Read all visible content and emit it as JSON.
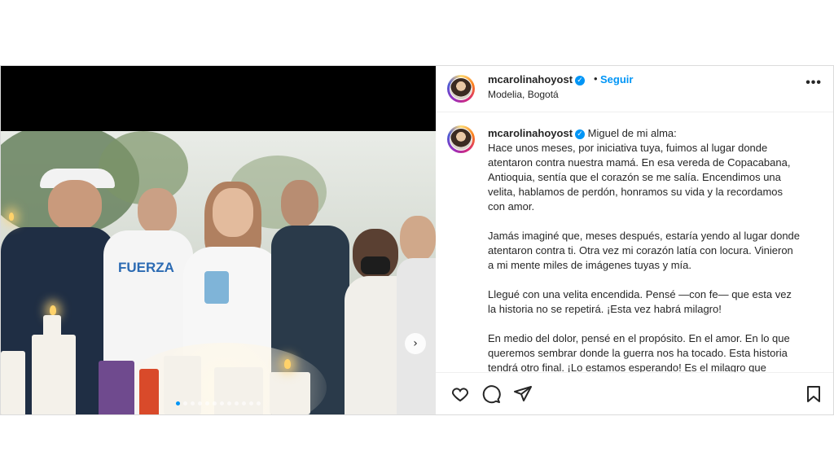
{
  "post": {
    "username": "mcarolinahoyost",
    "verified": true,
    "follow_label": "Seguir",
    "separator": "•",
    "location": "Modelia, Bogotá",
    "more_label": "•••"
  },
  "photo": {
    "shirt_text": "FUERZA",
    "carousel_dots": 12,
    "active_dot": 0
  },
  "caption": {
    "username": "mcarolinahoyost",
    "lines": [
      "Miguel de mi alma:",
      "Hace unos meses, por iniciativa tuya, fuimos al lugar donde",
      "atentaron contra nuestra mamá. En esa vereda de Copacabana,",
      "Antioquia, sentía que el corazón se me salía. Encendimos una",
      "velita, hablamos de perdón, honramos su vida y la recordamos",
      "con amor.",
      "",
      "Jamás imaginé que, meses después, estaría yendo al lugar donde",
      "atentaron contra ti. Otra vez mi corazón latía con locura. Vinieron",
      "a mi mente miles de imágenes tuyas y mía.",
      "",
      "Llegué con una velita encendida. Pensé —con fe— que esta vez",
      "la historia no se repetirá. ¡Esta vez habrá milagro!",
      "",
      "En medio del dolor, pensé en el propósito. En el amor. En lo que",
      "queremos sembrar donde la guerra nos ha tocado. Esta historia",
      "tendrá otro final. ¡Lo estamos esperando! Es el milagro que"
    ]
  },
  "actions": {
    "icons": [
      "heart-icon",
      "comment-icon",
      "share-icon",
      "bookmark-icon"
    ]
  },
  "colors": {
    "link_blue": "#0095f6",
    "text": "#262626",
    "border": "#dbdbdb"
  }
}
